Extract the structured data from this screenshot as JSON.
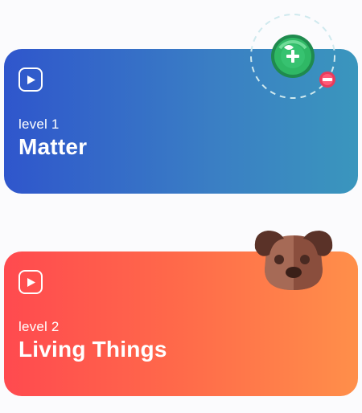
{
  "cards": [
    {
      "level_label": "level 1",
      "title": "Matter",
      "play_icon": "play-icon",
      "illustration_icon": "atom-molecule-icon",
      "colors": {
        "gradient_start": "#2f56cc",
        "gradient_end": "#3a96bd"
      }
    },
    {
      "level_label": "level 2",
      "title": "Living Things",
      "play_icon": "play-icon",
      "illustration_icon": "dog-face-icon",
      "colors": {
        "gradient_start": "#ff4a4f",
        "gradient_end": "#ff8f4a"
      }
    }
  ]
}
